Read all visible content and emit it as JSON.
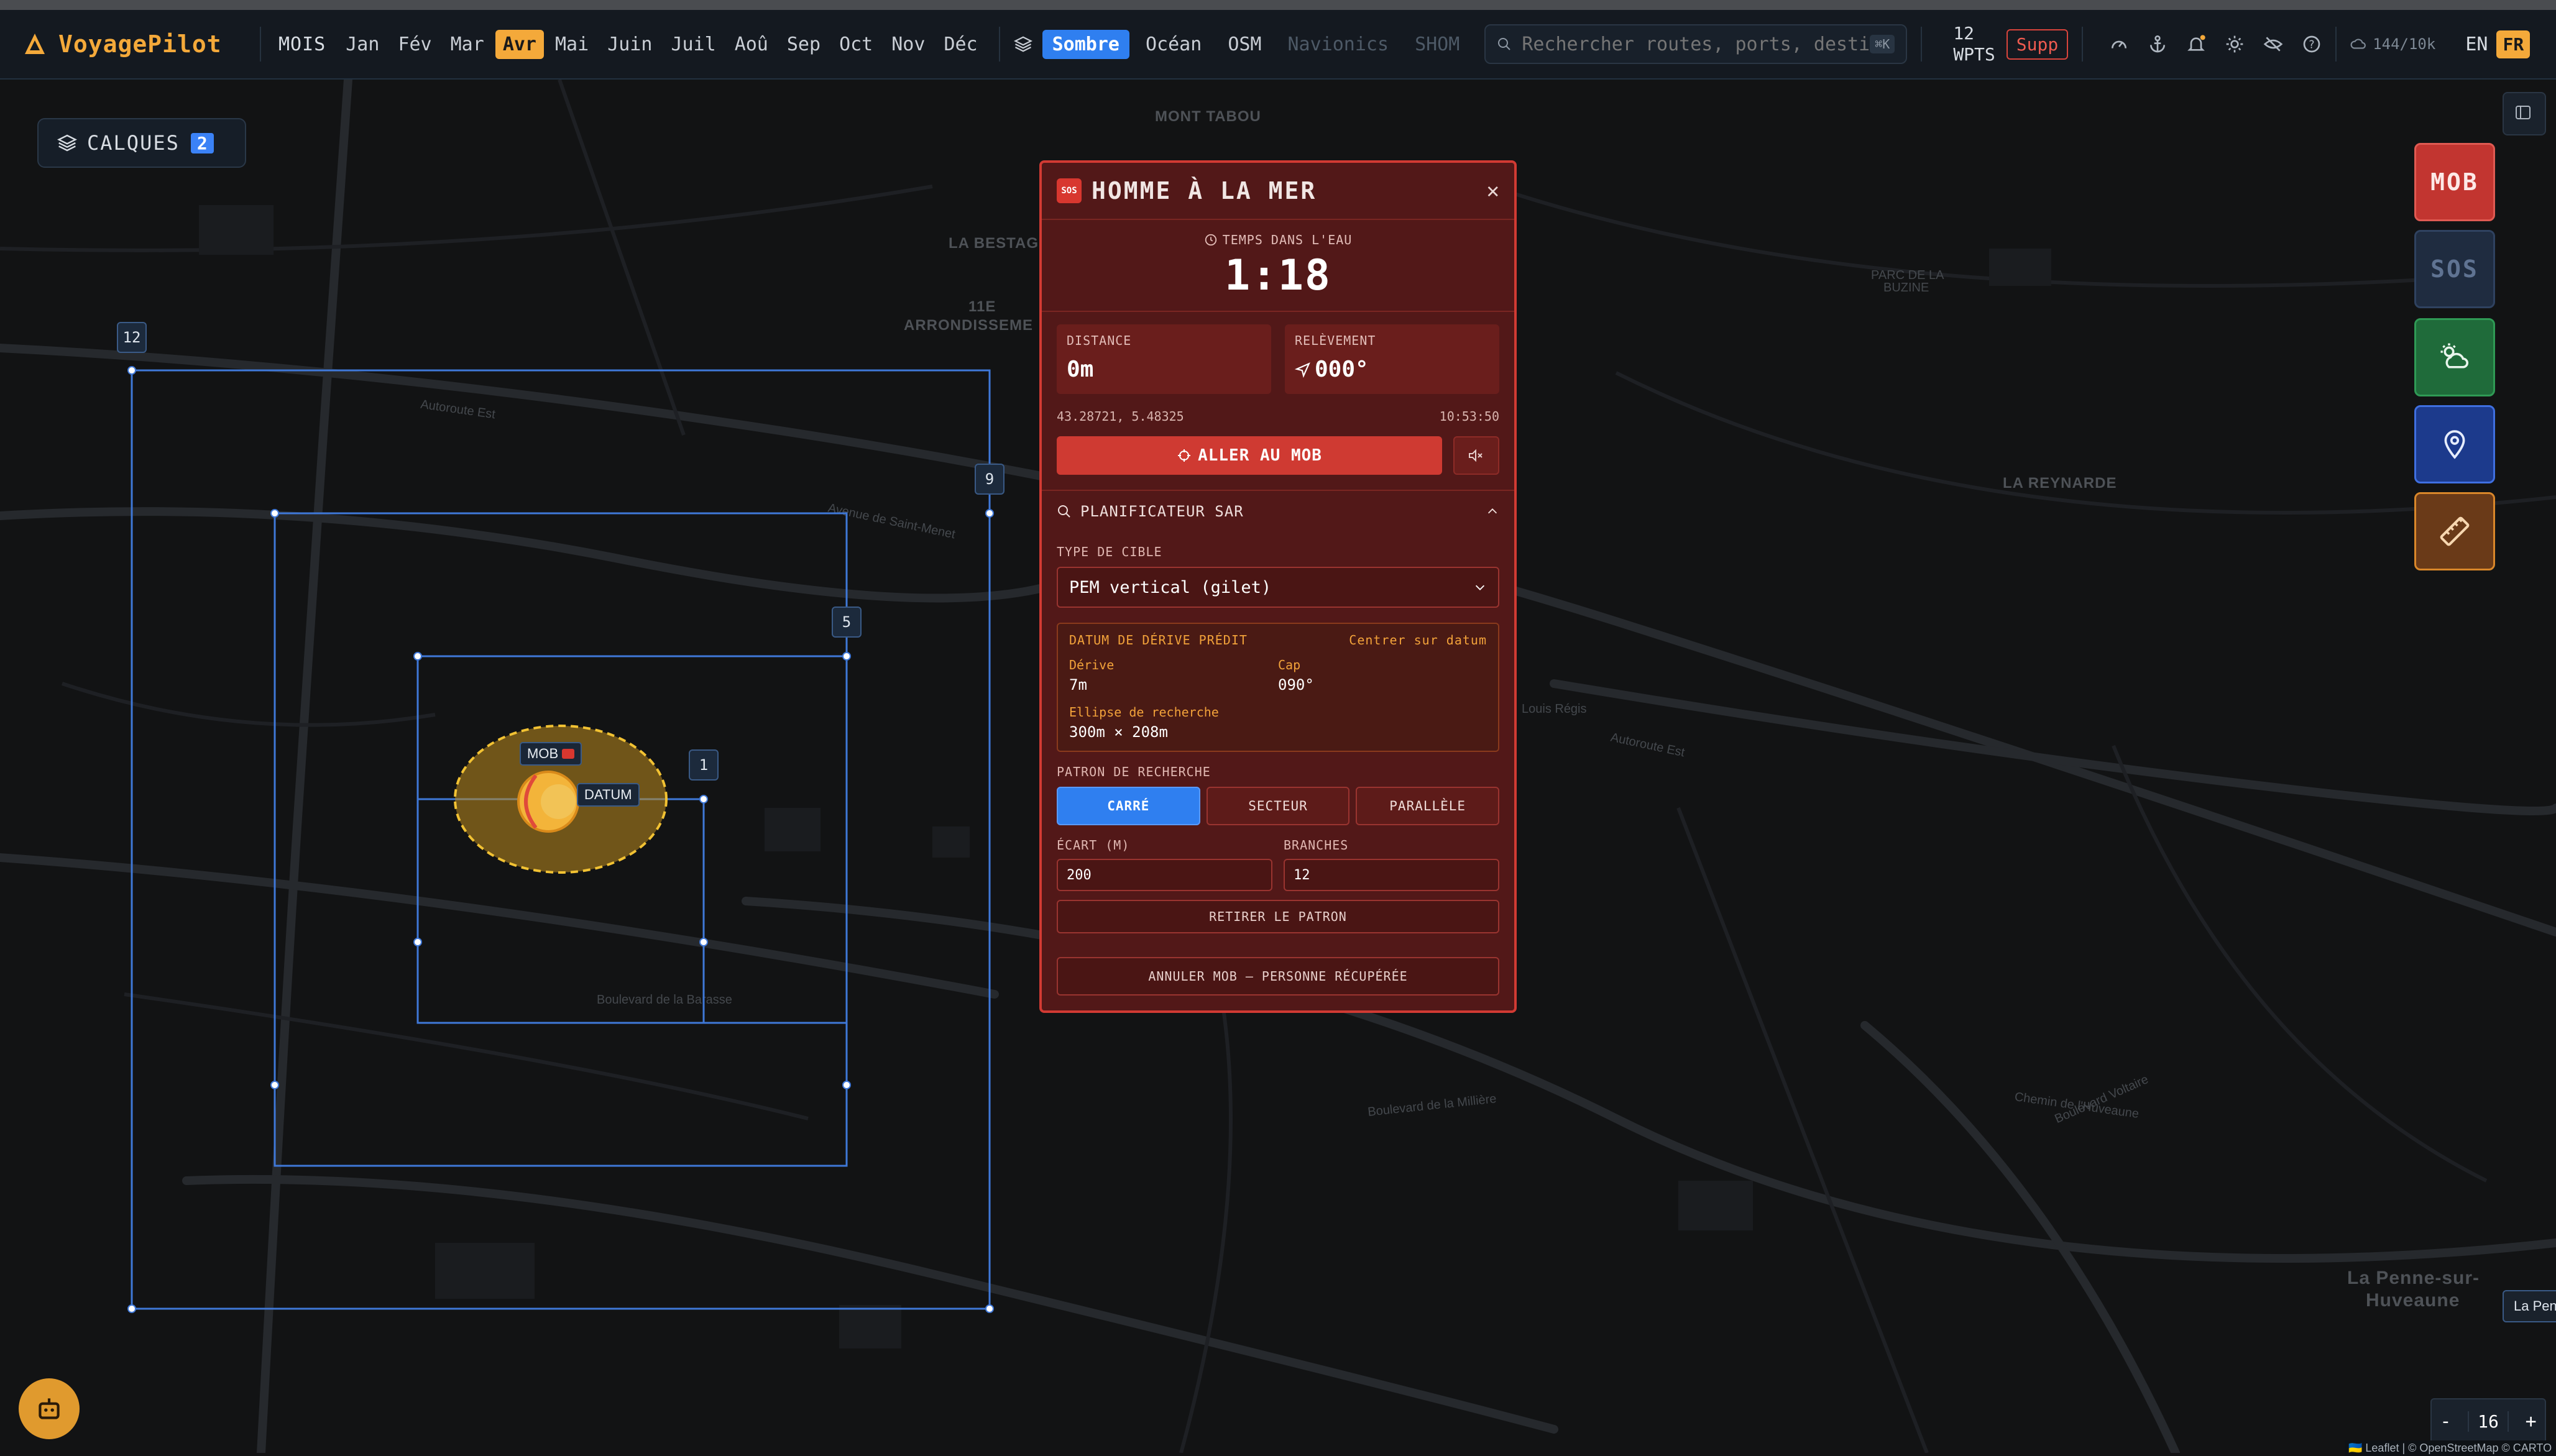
{
  "app": {
    "name": "VoyagePilot",
    "accent": "#f4a93a"
  },
  "months": {
    "label": "MOIS",
    "items": [
      "Jan",
      "Fév",
      "Mar",
      "Avr",
      "Mai",
      "Juin",
      "Juil",
      "Aoû",
      "Sep",
      "Oct",
      "Nov",
      "Déc"
    ],
    "selected": "Avr"
  },
  "basemaps": {
    "items": [
      "Sombre",
      "Océan",
      "OSM",
      "Navionics",
      "SHOM"
    ],
    "selected": "Sombre",
    "disabled": [
      "Navionics",
      "SHOM"
    ]
  },
  "search": {
    "placeholder": "Rechercher routes, ports, destin",
    "shortcut": "⌘K"
  },
  "waypoints": {
    "count": "12",
    "unit": "WPTS",
    "delete_label": "Supp"
  },
  "toolbar_icons": [
    "gauge-icon",
    "anchor-icon",
    "bell-icon",
    "sun-icon",
    "eye-off-icon",
    "help-icon"
  ],
  "quota": "144/10k",
  "languages": {
    "inactive": "EN",
    "active": "FR"
  },
  "layers": {
    "label": "CALQUES",
    "count": "2"
  },
  "map_labels": {
    "mont_tabou": "MONT TABOU",
    "la_bestag": "LA BESTAG",
    "arr1": "11E",
    "arr2": "ARRONDISSEME",
    "parc1": "PARC DE LA",
    "parc2": "BUZINE",
    "reynarde": "LA REYNARDE",
    "penne1": "La Penne-sur-",
    "penne2": "Huveaune",
    "autoroute1": "Autoroute Est",
    "autoroute2": "Autoroute Est",
    "saint_menet": "Avenue de Saint-Menet",
    "barasse": "Boulevard de la Barasse",
    "milliere": "Boulevard de la Millière",
    "voltaire": "Boulevard Voltaire",
    "huveaune": "Chemin de l'Huveaune",
    "louis_regis": "Louis Régis"
  },
  "search_pattern": {
    "legs": [
      "12",
      "9",
      "5",
      "1"
    ],
    "mob_tag": "MOB",
    "datum_tag": "DATUM"
  },
  "mob_panel": {
    "title": "HOMME À LA MER",
    "time_label": "TEMPS DANS L'EAU",
    "time_value": "1:18",
    "distance_label": "DISTANCE",
    "distance_value": "0m",
    "bearing_label": "RELÈVEMENT",
    "bearing_value": "000°",
    "coords": "43.28721, 5.48325",
    "timestamp": "10:53:50",
    "goto_label": "ALLER AU MOB",
    "sar_title": "PLANIFICATEUR SAR",
    "target_type_label": "TYPE DE CIBLE",
    "target_type_value": "PEM vertical (gilet)",
    "datum_title": "DATUM DE DÉRIVE PRÉDIT",
    "datum_center": "Centrer sur datum",
    "drift_label": "Dérive",
    "drift_value": "7m",
    "heading_label": "Cap",
    "heading_value": "090°",
    "ellipse_label": "Ellipse de recherche",
    "ellipse_value": "300m × 208m",
    "pattern_label": "PATRON DE RECHERCHE",
    "patterns": [
      "CARRÉ",
      "SECTEUR",
      "PARALLÈLE"
    ],
    "pattern_selected": "CARRÉ",
    "spacing_label": "ÉCART (M)",
    "spacing_value": "200",
    "branches_label": "BRANCHES",
    "branches_value": "12",
    "remove_pattern": "RETIRER LE PATRON",
    "cancel_mob": "ANNULER MOB — PERSONNE RÉCUPÉRÉE"
  },
  "right_tools": {
    "mob": "MOB",
    "sos": "SOS"
  },
  "zoom": {
    "minus": "-",
    "level": "16",
    "plus": "+"
  },
  "place_tag": "La Penne",
  "attribution": "🇺🇦 Leaflet | © OpenStreetMap © CARTO"
}
